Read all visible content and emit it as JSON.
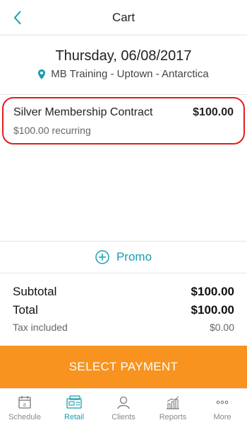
{
  "header": {
    "title": "Cart"
  },
  "appointment": {
    "date": "Thursday, 06/08/2017",
    "location": "MB Training - Uptown - Antarctica"
  },
  "cart_items": [
    {
      "name": "Silver Membership Contract",
      "price": "$100.00",
      "subtext": "$100.00 recurring"
    }
  ],
  "promo": {
    "label": "Promo"
  },
  "summary": {
    "subtotal_label": "Subtotal",
    "subtotal_value": "$100.00",
    "total_label": "Total",
    "total_value": "$100.00",
    "tax_label": "Tax included",
    "tax_value": "$0.00"
  },
  "payment_button": {
    "label": "SELECT PAYMENT"
  },
  "tabbar": {
    "items": [
      {
        "label": "Schedule",
        "icon": "calendar-icon"
      },
      {
        "label": "Retail",
        "icon": "register-icon",
        "active": true
      },
      {
        "label": "Clients",
        "icon": "client-icon"
      },
      {
        "label": "Reports",
        "icon": "chart-icon"
      },
      {
        "label": "More",
        "icon": "more-icon"
      }
    ]
  },
  "colors": {
    "accent": "#1a9db0",
    "payment_button": "#f7931e",
    "highlight_outline": "#e01e1e"
  }
}
